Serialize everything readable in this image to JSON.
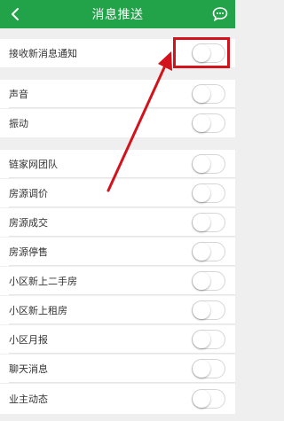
{
  "header": {
    "title": "消息推送",
    "back_icon": "chevron-left-icon",
    "chat_icon": "chat-bubble-icon"
  },
  "rows": [
    {
      "label": "接收新消息通知",
      "on": false
    },
    {
      "label": "声音",
      "on": false
    },
    {
      "label": "振动",
      "on": false
    },
    {
      "label": "链家网团队",
      "on": false
    },
    {
      "label": "房源调价",
      "on": false
    },
    {
      "label": "房源成交",
      "on": false
    },
    {
      "label": "房源停售",
      "on": false
    },
    {
      "label": "小区新上二手房",
      "on": false
    },
    {
      "label": "小区新上租房",
      "on": false
    },
    {
      "label": "小区月报",
      "on": false
    },
    {
      "label": "聊天消息",
      "on": false
    },
    {
      "label": "业主动态",
      "on": false
    }
  ],
  "colors": {
    "header_bg": "#22a34a",
    "annotation": "#d3131b"
  }
}
